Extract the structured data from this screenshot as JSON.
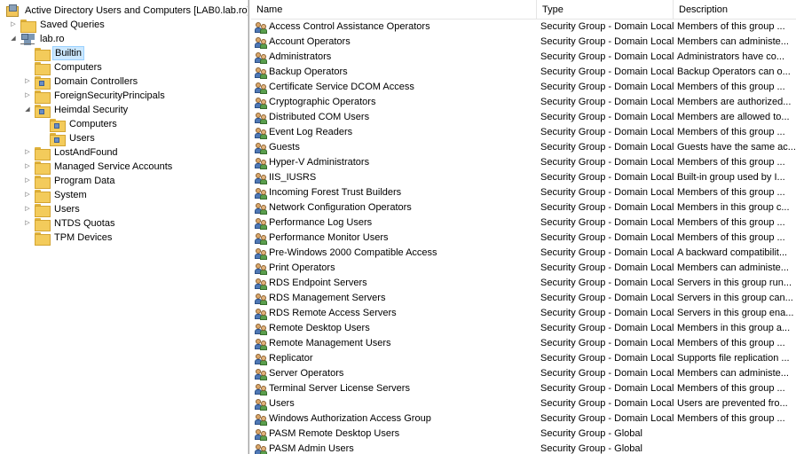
{
  "tree": {
    "root": "Active Directory Users and Computers [LAB0.lab.ro]",
    "saved_queries": "Saved Queries",
    "domain": "lab.ro",
    "builtin": "Builtin",
    "computers": "Computers",
    "domain_controllers": "Domain Controllers",
    "foreign_security_principals": "ForeignSecurityPrincipals",
    "heimdal_security": "Heimdal Security",
    "heimdal_computers": "Computers",
    "heimdal_users": "Users",
    "lost_and_found": "LostAndFound",
    "managed_service_accounts": "Managed Service Accounts",
    "program_data": "Program Data",
    "system": "System",
    "users": "Users",
    "ntds_quotas": "NTDS Quotas",
    "tpm_devices": "TPM Devices"
  },
  "list": {
    "columns": {
      "name": "Name",
      "type": "Type",
      "description": "Description"
    },
    "rows": [
      {
        "name": "Access Control Assistance Operators",
        "type": "Security Group - Domain Local",
        "description": "Members of this group ..."
      },
      {
        "name": "Account Operators",
        "type": "Security Group - Domain Local",
        "description": "Members can administe..."
      },
      {
        "name": "Administrators",
        "type": "Security Group - Domain Local",
        "description": "Administrators have co..."
      },
      {
        "name": "Backup Operators",
        "type": "Security Group - Domain Local",
        "description": "Backup Operators can o..."
      },
      {
        "name": "Certificate Service DCOM Access",
        "type": "Security Group - Domain Local",
        "description": "Members of this group ..."
      },
      {
        "name": "Cryptographic Operators",
        "type": "Security Group - Domain Local",
        "description": "Members are authorized..."
      },
      {
        "name": "Distributed COM Users",
        "type": "Security Group - Domain Local",
        "description": "Members are allowed to..."
      },
      {
        "name": "Event Log Readers",
        "type": "Security Group - Domain Local",
        "description": "Members of this group ..."
      },
      {
        "name": "Guests",
        "type": "Security Group - Domain Local",
        "description": "Guests have the same ac..."
      },
      {
        "name": "Hyper-V Administrators",
        "type": "Security Group - Domain Local",
        "description": "Members of this group ..."
      },
      {
        "name": "IIS_IUSRS",
        "type": "Security Group - Domain Local",
        "description": "Built-in group used by I..."
      },
      {
        "name": "Incoming Forest Trust Builders",
        "type": "Security Group - Domain Local",
        "description": "Members of this group ..."
      },
      {
        "name": "Network Configuration Operators",
        "type": "Security Group - Domain Local",
        "description": "Members in this group c..."
      },
      {
        "name": "Performance Log Users",
        "type": "Security Group - Domain Local",
        "description": "Members of this group ..."
      },
      {
        "name": "Performance Monitor Users",
        "type": "Security Group - Domain Local",
        "description": "Members of this group ..."
      },
      {
        "name": "Pre-Windows 2000 Compatible Access",
        "type": "Security Group - Domain Local",
        "description": "A backward compatibilit..."
      },
      {
        "name": "Print Operators",
        "type": "Security Group - Domain Local",
        "description": "Members can administe..."
      },
      {
        "name": "RDS Endpoint Servers",
        "type": "Security Group - Domain Local",
        "description": "Servers in this group run..."
      },
      {
        "name": "RDS Management Servers",
        "type": "Security Group - Domain Local",
        "description": "Servers in this group can..."
      },
      {
        "name": "RDS Remote Access Servers",
        "type": "Security Group - Domain Local",
        "description": "Servers in this group ena..."
      },
      {
        "name": "Remote Desktop Users",
        "type": "Security Group - Domain Local",
        "description": "Members in this group a..."
      },
      {
        "name": "Remote Management Users",
        "type": "Security Group - Domain Local",
        "description": "Members of this group ..."
      },
      {
        "name": "Replicator",
        "type": "Security Group - Domain Local",
        "description": "Supports file replication ..."
      },
      {
        "name": "Server Operators",
        "type": "Security Group - Domain Local",
        "description": "Members can administe..."
      },
      {
        "name": "Terminal Server License Servers",
        "type": "Security Group - Domain Local",
        "description": "Members of this group ..."
      },
      {
        "name": "Users",
        "type": "Security Group - Domain Local",
        "description": "Users are prevented fro..."
      },
      {
        "name": "Windows Authorization Access Group",
        "type": "Security Group - Domain Local",
        "description": "Members of this group ..."
      },
      {
        "name": "PASM Remote Desktop Users",
        "type": "Security Group - Global",
        "description": ""
      },
      {
        "name": "PASM Admin Users",
        "type": "Security Group - Global",
        "description": ""
      }
    ]
  }
}
